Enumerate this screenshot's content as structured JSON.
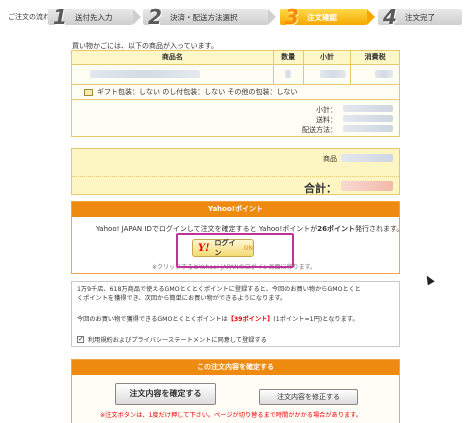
{
  "steps": {
    "label": "ご注文の流れ:",
    "items": [
      {
        "num": "1",
        "label": "送付先入力"
      },
      {
        "num": "2",
        "label": "決済・配送方法選択"
      },
      {
        "num": "3",
        "label": "注文確認"
      },
      {
        "num": "4",
        "label": "注文完了"
      }
    ],
    "active_index": 3
  },
  "cart": {
    "intro": "買い物かごには、以下の商品が入っています。",
    "headers": {
      "name": "商品名",
      "qty": "数量",
      "subtotal": "小計",
      "tax": "消費税"
    },
    "gift": "ギフト包装：しない のし付包装：しない その他の包装：しない",
    "summary_labels": {
      "subtotal": "小計：",
      "shipping": "送料：",
      "delivery": "配送方法："
    },
    "product_label": "商品",
    "total_label": "合計："
  },
  "yahoo": {
    "header": "Yahoo!ポイント",
    "text_pre": "Yahoo! JAPAN IDでログインして注文を確定すると Yahoo!ポイントが",
    "text_points": "26ポイント",
    "text_post": "発行されます。",
    "login_logo": "Y!",
    "login_label": "ログイン",
    "login_suffix": "ON",
    "note": "※クリックするとYahoo! JAPANのログイン画面に移ります。"
  },
  "gmo": {
    "line1": "1万9千店、618万商品で使えるGMOとくとくポイントに登録すると、今回のお買い物からGMOとくと",
    "line2": "くポイントを獲得でき、次回から簡単にお買い物ができるようになります。",
    "line3_pre": "今回のお買い物で獲得できるGMOとくとくポイントは",
    "line3_points": "【39ポイント】",
    "line3_post": "(1ポイント=1円)となります。",
    "checkbox_label": "利用規約およびプライバシーステートメントに同意して登録する",
    "checkbox_checked": true
  },
  "confirm": {
    "header": "この注文内容を確定する",
    "confirm_button": "注文内容を確定する",
    "edit_button": "注文内容を修正する",
    "note": "※注文ボタンは、1度だけ押して下さい。ページが切り替るまで時間がかかる場合があります。"
  },
  "colors": {
    "accent_orange": "#ef8a10",
    "panel_yellow": "#fdf6c3",
    "highlight": "#c0349a",
    "warning_red": "#e00000"
  }
}
